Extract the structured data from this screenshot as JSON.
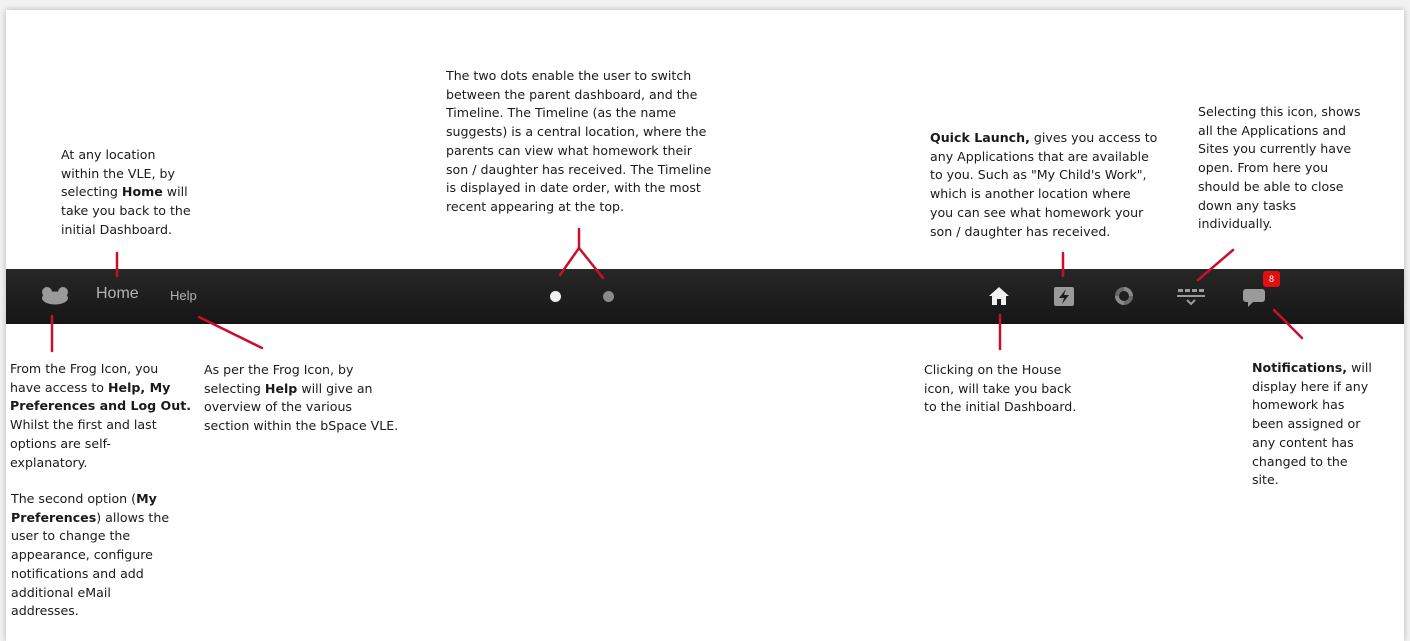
{
  "navbar": {
    "home_label": "Home",
    "help_label": "Help",
    "notification_count": "8",
    "icons": [
      "frog-icon",
      "house-icon",
      "quick-launch-icon",
      "spinner-icon",
      "open-tasks-icon",
      "notifications-icon"
    ]
  },
  "annotations": {
    "home": {
      "lines": [
        "At any location",
        "within the VLE, by",
        "selecting |Home| will",
        "take you back to the",
        "initial Dashboard."
      ]
    },
    "dots": {
      "lines": [
        "The two dots enable the user to switch",
        "between the parent dashboard, and the",
        "Timeline. The Timeline (as the name",
        "suggests) is a central location, where the",
        "parents can view what homework their",
        "son / daughter has received. The Timeline",
        "is displayed in date order, with the most",
        "recent appearing at the top."
      ]
    },
    "quick_launch": {
      "lines": [
        "|Quick Launch,| gives you access to",
        "any Applications that are available",
        "to you. Such as \"My Child's Work\",",
        "which is another location where",
        "you can see what homework your",
        "son / daughter has received."
      ]
    },
    "tasks": {
      "lines": [
        "Selecting this icon, shows",
        "all the Applications and",
        "Sites you currently have",
        "open. From here you",
        "should be able to close",
        "down any tasks",
        "individually."
      ]
    },
    "frog": {
      "lines": [
        "From the Frog Icon, you",
        "have access to |Help, My|",
        "|Preferences and Log Out.|",
        "Whilst the first and last",
        "options are self-",
        "explanatory."
      ]
    },
    "preferences": {
      "lines": [
        "The second option (|My|",
        "|Preferences|) allows the",
        "user to change the",
        "appearance, configure",
        "notifications and add",
        "additional eMail",
        "addresses."
      ]
    },
    "help": {
      "lines": [
        "As per the Frog Icon, by",
        "selecting |Help| will give an",
        "overview of the various",
        "section within the bSpace VLE."
      ]
    },
    "house": {
      "lines": [
        "Clicking on the House",
        "icon, will take you back",
        "to the initial Dashboard."
      ]
    },
    "notifications": {
      "lines": [
        "|Notifications,| will",
        "display here if any",
        "homework has",
        "been assigned or",
        "any content has",
        "changed to the",
        "site."
      ]
    }
  },
  "colors": {
    "navbar_bg": "#1e1e1e",
    "pointer_red": "#c8102e",
    "badge_red": "#e01010",
    "nav_text": "#b3b3b3",
    "icon_grey": "#9a9a9a"
  }
}
